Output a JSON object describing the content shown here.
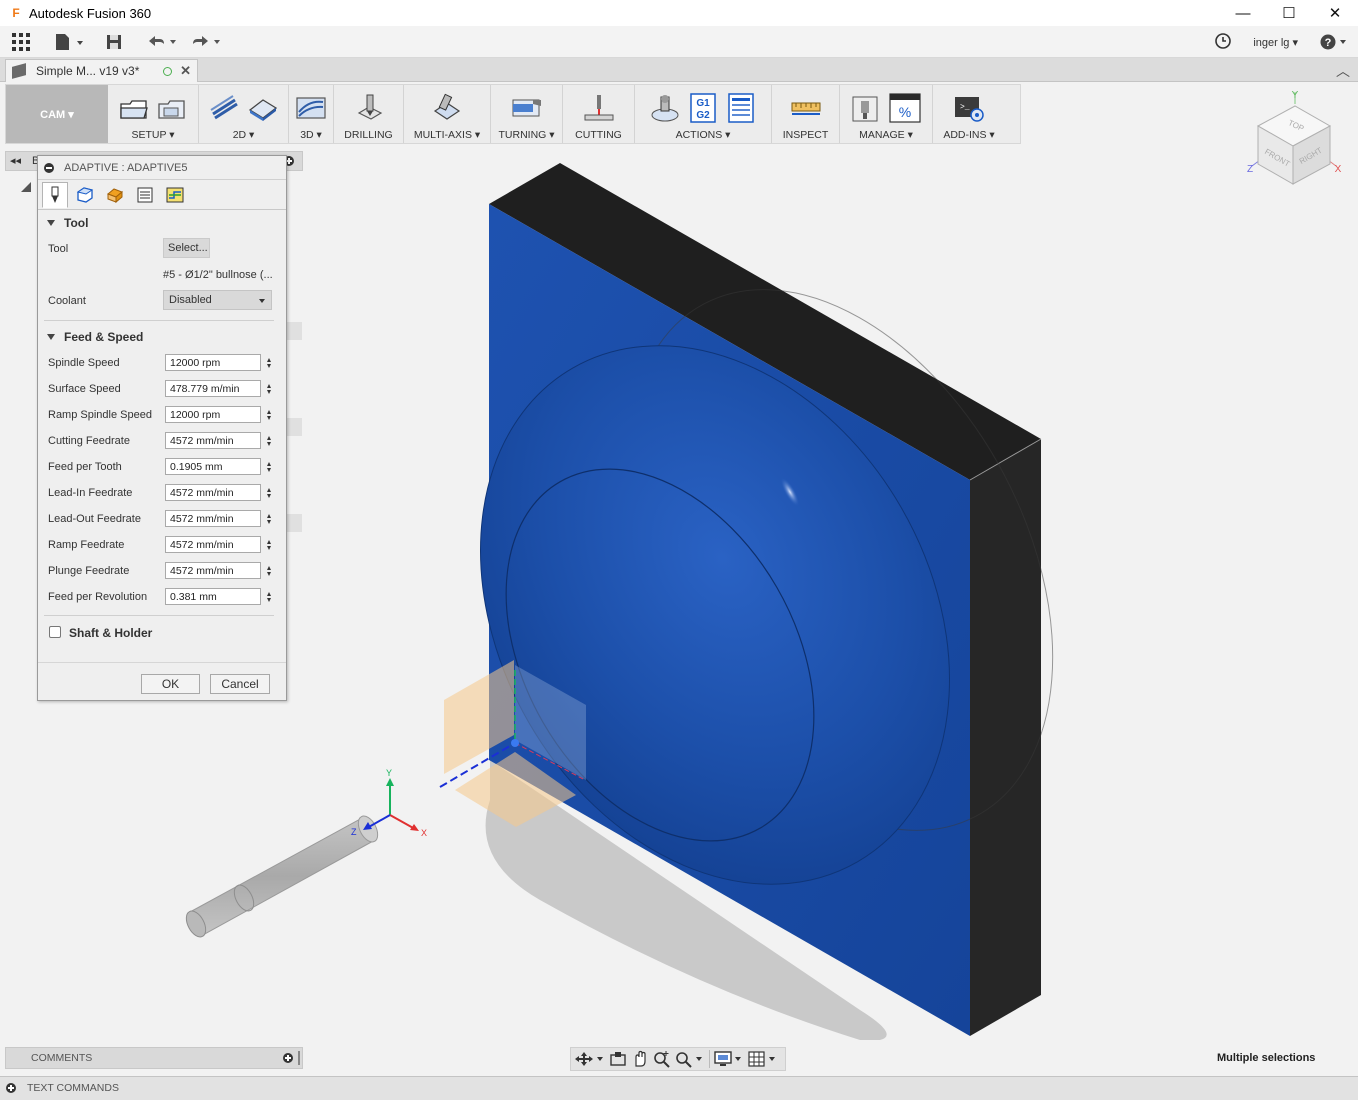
{
  "app": {
    "title": "Autodesk Fusion 360",
    "logo_letter": "F"
  },
  "window_controls": {
    "minimize": "—",
    "maximize": "☐",
    "close": "✕"
  },
  "user": {
    "name": "inger lg"
  },
  "document_tab": {
    "title": "Simple M... v19 v3*"
  },
  "ribbon": {
    "workspace": "CAM ▾",
    "groups": [
      {
        "label": "SETUP ▾"
      },
      {
        "label": "2D ▾"
      },
      {
        "label": "3D ▾"
      },
      {
        "label": "DRILLING"
      },
      {
        "label": "MULTI-AXIS ▾"
      },
      {
        "label": "TURNING ▾"
      },
      {
        "label": "CUTTING"
      },
      {
        "label": "ACTIONS ▾"
      },
      {
        "label": "INSPECT"
      },
      {
        "label": "MANAGE ▾"
      },
      {
        "label": "ADD-INS ▾"
      }
    ],
    "g1g2_text": "G1 G2",
    "percent_text": "%"
  },
  "viewcube": {
    "top": "TOP",
    "front": "FRONT",
    "right": "RIGHT",
    "x": "X",
    "y": "Y",
    "z": "Z"
  },
  "browser": {
    "label": "B"
  },
  "dialog": {
    "title": "ADAPTIVE : ADAPTIVE5",
    "tool_section": "Tool",
    "tool_label": "Tool",
    "tool_button": "Select...",
    "tool_name": "#5 - Ø1/2\" bullnose (...",
    "coolant_label": "Coolant",
    "coolant_value": "Disabled",
    "feed_section": "Feed & Speed",
    "fields": [
      {
        "label": "Spindle Speed",
        "value": "12000 rpm"
      },
      {
        "label": "Surface Speed",
        "value": "478.779 m/min"
      },
      {
        "label": "Ramp Spindle Speed",
        "value": "12000 rpm"
      },
      {
        "label": "Cutting Feedrate",
        "value": "4572 mm/min"
      },
      {
        "label": "Feed per Tooth",
        "value": "0.1905 mm"
      },
      {
        "label": "Lead-In Feedrate",
        "value": "4572 mm/min"
      },
      {
        "label": "Lead-Out Feedrate",
        "value": "4572 mm/min"
      },
      {
        "label": "Ramp Feedrate",
        "value": "4572 mm/min"
      },
      {
        "label": "Plunge Feedrate",
        "value": "4572 mm/min"
      },
      {
        "label": "Feed per Revolution",
        "value": "0.381 mm"
      }
    ],
    "shaft_section": "Shaft & Holder",
    "ok": "OK",
    "cancel": "Cancel"
  },
  "triad": {
    "x": "X",
    "y": "Y",
    "z": "Z"
  },
  "bottom": {
    "comments": "COMMENTS",
    "text_commands": "TEXT COMMANDS",
    "status": "Multiple selections"
  },
  "colors": {
    "face_blue": "#1a4ea8",
    "stock_dark": "#232323",
    "ribbon_bg": "#ececec",
    "workspace_bg": "#b8b8b8"
  }
}
